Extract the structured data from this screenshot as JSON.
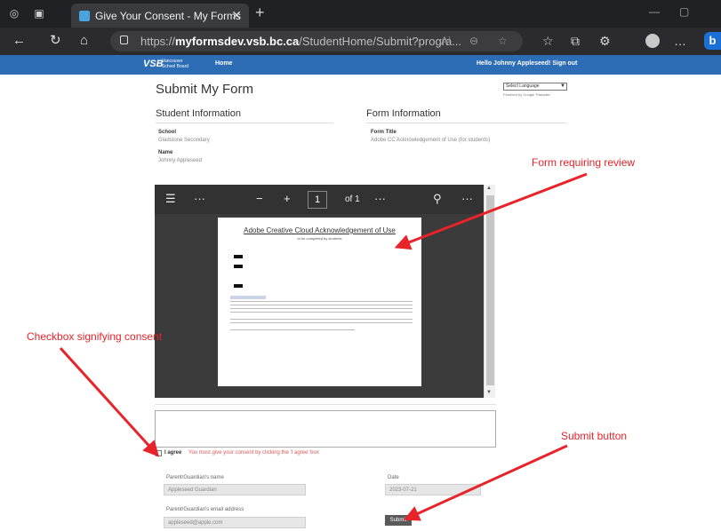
{
  "browser": {
    "tab_title": "Give Your Consent - My Forms",
    "url_prefix": "https://",
    "url_host": "myformsdev.vsb.bc.ca",
    "url_path": "/StudentHome/Submit?progra..."
  },
  "icons": {
    "workspaces": "workspaces-icon",
    "tab_actions": "tab-actions-icon",
    "back": "back-icon",
    "refresh": "refresh-icon",
    "home": "home-icon",
    "lock": "lock-icon",
    "read_aloud": "read-aloud-icon",
    "zoom": "zoom-icon",
    "favorite": "favorite-icon",
    "favorites": "favorites-icon",
    "collections": "collections-icon",
    "extensions": "extensions-icon",
    "profile": "profile-icon",
    "menu": "more-icon",
    "bing": "bing-icon"
  },
  "site": {
    "logo": "VSB",
    "logo_sub": "Vancouver School Board",
    "nav_home": "Home",
    "greeting": "Hello Johnny Appleseed!",
    "sign_out": "Sign out"
  },
  "page": {
    "title": "Submit My Form",
    "language_select": "Select Language",
    "translate_note": "Powered by Google Translate"
  },
  "student_info": {
    "heading": "Student Information",
    "school_label": "School",
    "school_value": "Gladstone Secondary",
    "name_label": "Name",
    "name_value": "Johnny Appleseed"
  },
  "form_info": {
    "heading": "Form Information",
    "title_label": "Form Title",
    "title_value": "Adobe CC Acknowledgement of Use (for students)"
  },
  "pdf": {
    "page_number": "1",
    "of_label": "of 1",
    "doc_title": "Adobe Creative Cloud Acknowledgement of Use",
    "doc_subtitle": "to be completed by students"
  },
  "consent": {
    "agree_label": "I agree",
    "agree_error": "You must give your consent by clicking the 'I agree' box"
  },
  "guardian": {
    "name_label": "Parent/Guardian's name",
    "name_value": "Appleseed Guardian",
    "email_label": "Parent/Guardian's email address",
    "email_value": "appleseed@apple.com",
    "date_label": "Date",
    "date_value": "2023-07-21",
    "submit_label": "Submit"
  },
  "annotations": {
    "form_review": "Form requiring review",
    "checkbox": "Checkbox signifying consent",
    "submit": "Submit button"
  },
  "colors": {
    "nav_blue": "#2d6db5",
    "annotation_red": "#e8232a",
    "error_red": "#e05555"
  }
}
